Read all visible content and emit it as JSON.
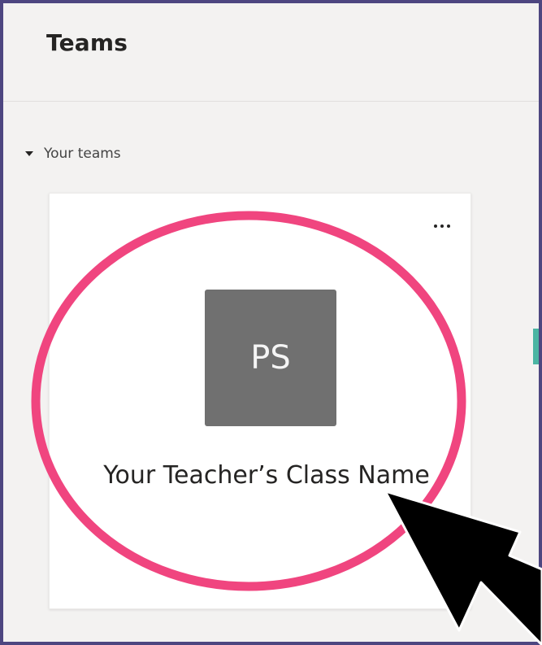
{
  "header": {
    "title": "Teams"
  },
  "sidebar": {
    "section_label": "Your teams"
  },
  "team_card": {
    "initials": "PS",
    "name": "Your Teacher’s Class Name",
    "avatar_color": "#707070",
    "more_icon": "more-options-icon"
  },
  "colors": {
    "frame_border": "#4d4680",
    "highlight_circle": "#f0457f",
    "accent": "#4ab5a3"
  }
}
